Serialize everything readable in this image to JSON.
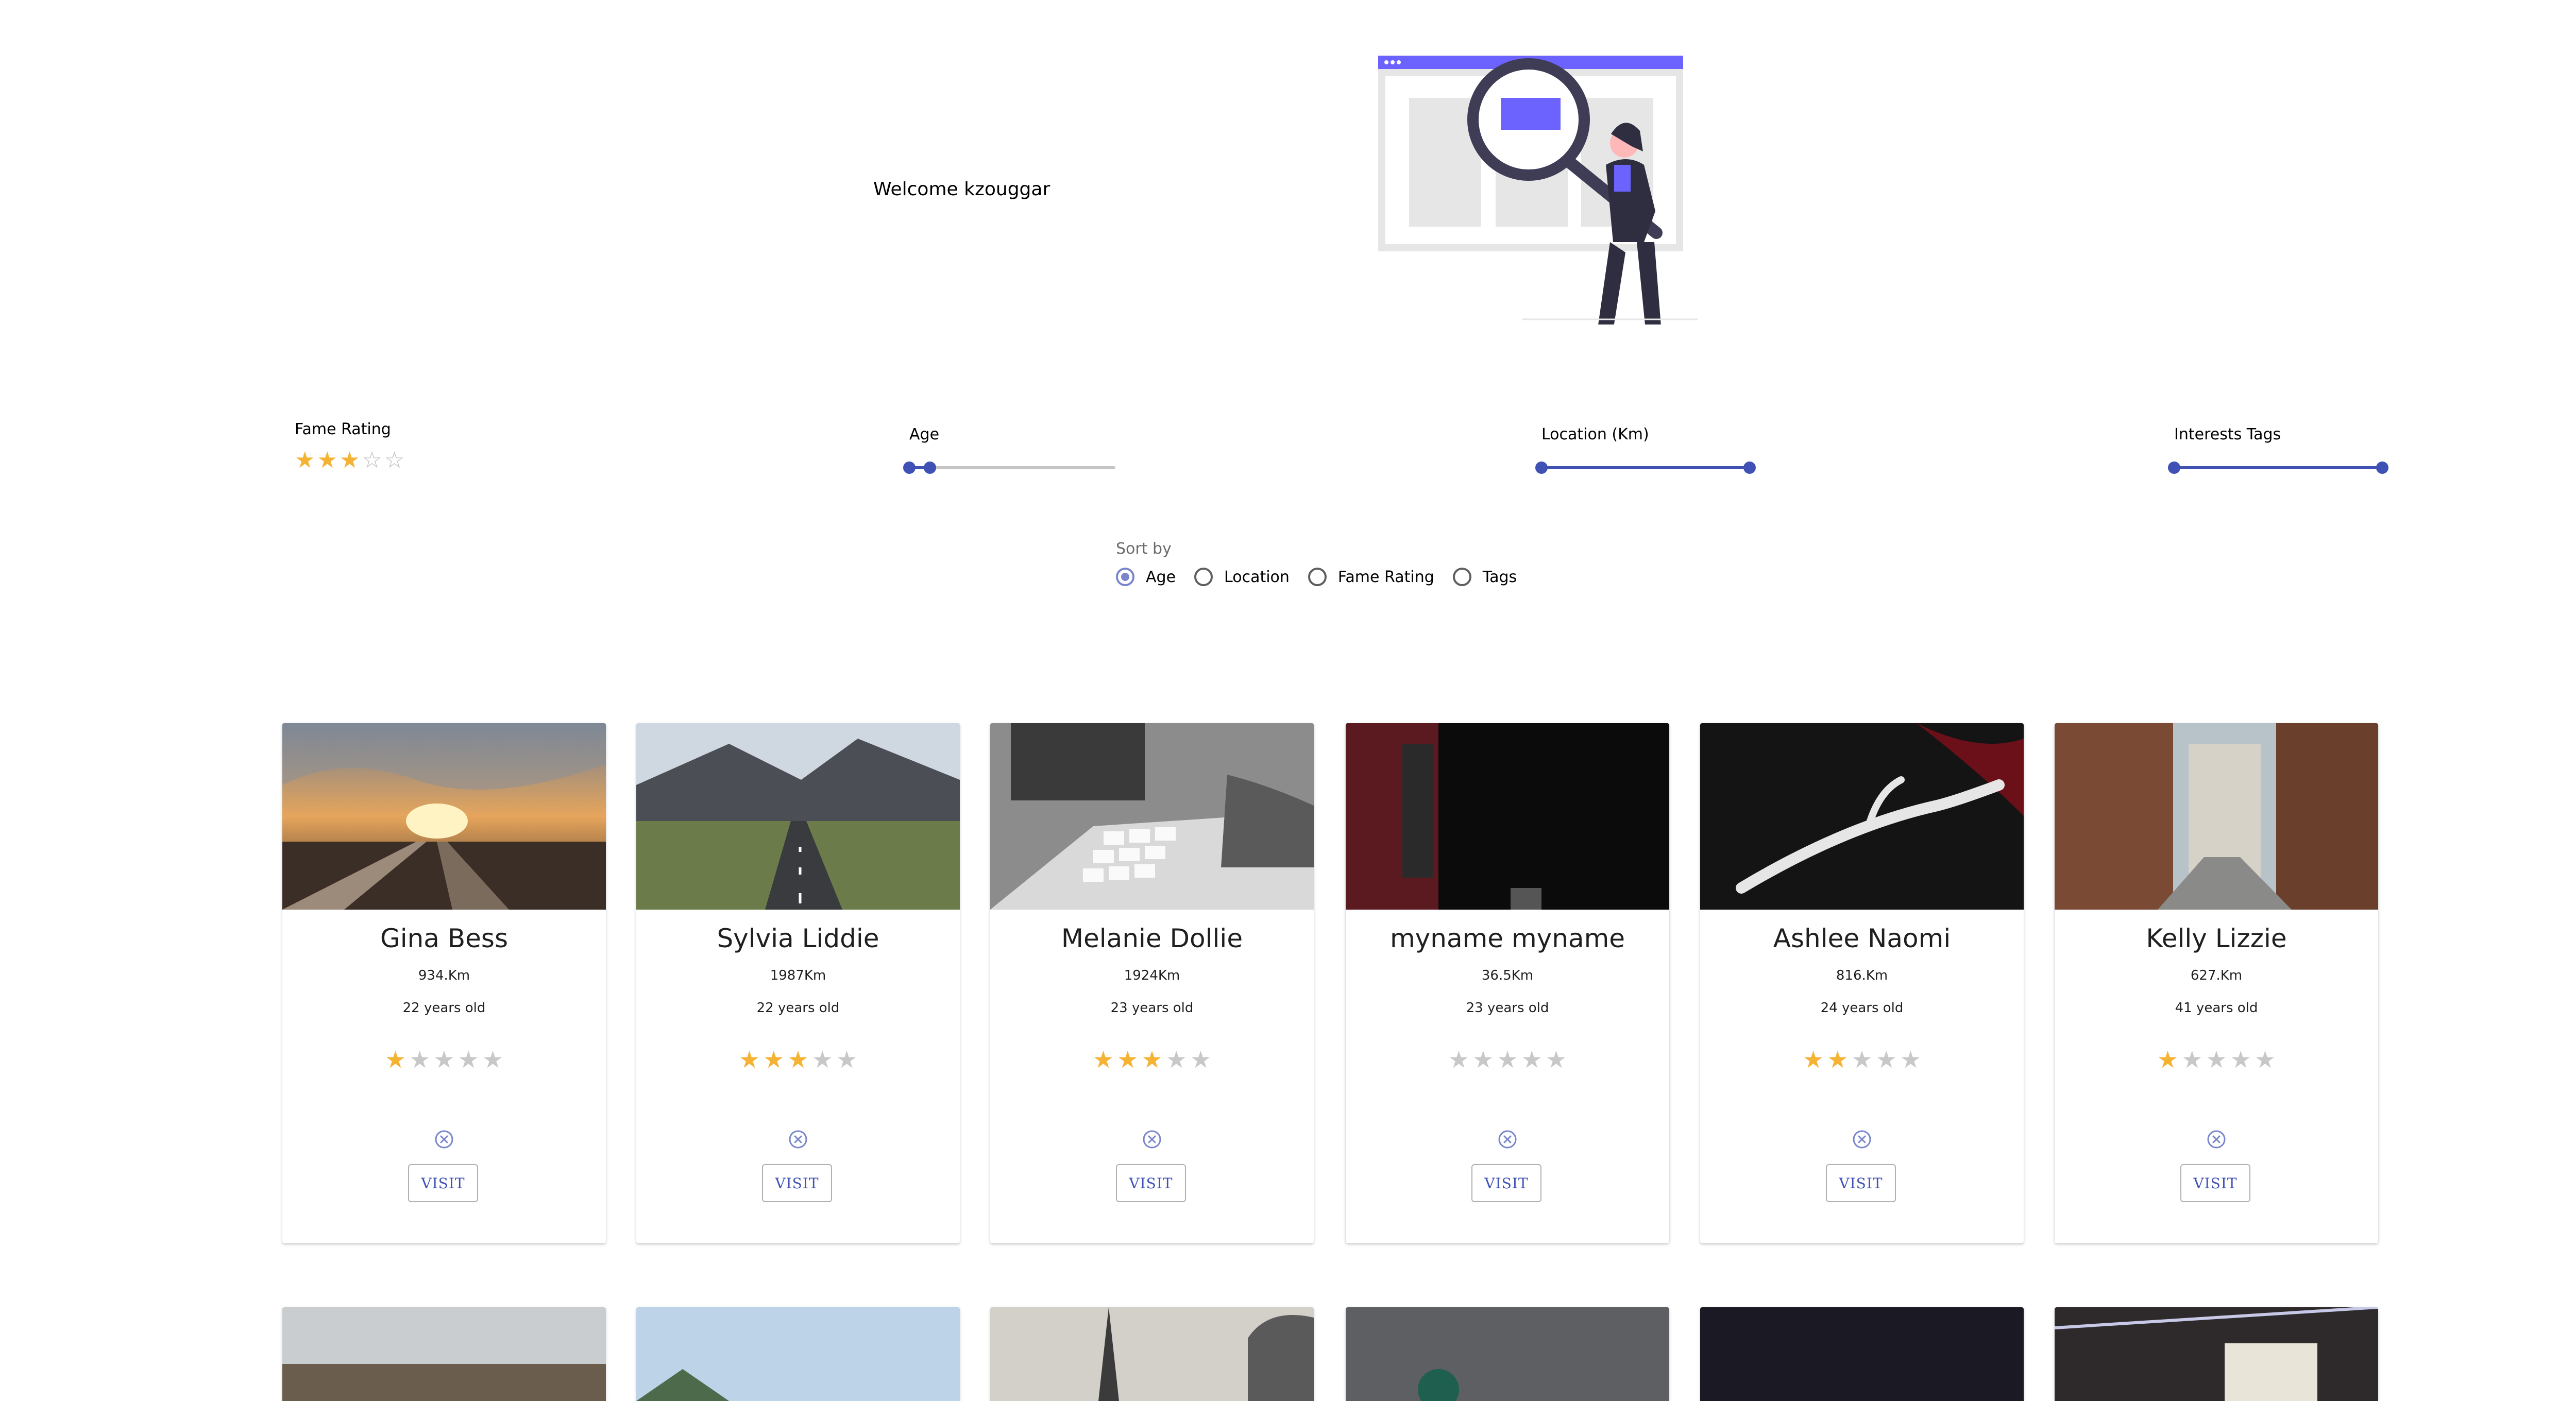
{
  "header": {
    "welcome_text": "Welcome kzouggar"
  },
  "filters": {
    "fame_label": "Fame Rating",
    "fame_value": 3,
    "fame_max": 5,
    "age_label": "Age",
    "location_label": "Location (Km)",
    "tags_label": "Interests Tags"
  },
  "sort": {
    "label": "Sort by",
    "options": [
      "Age",
      "Location",
      "Fame Rating",
      "Tags"
    ],
    "selected": "Age"
  },
  "profiles": [
    {
      "name": "Gina Bess",
      "distance": "934.Km",
      "age": "22 years old",
      "rating": 1,
      "visit": "VISIT"
    },
    {
      "name": "Sylvia Liddie",
      "distance": "1987Km",
      "age": "22 years old",
      "rating": 3,
      "visit": "VISIT"
    },
    {
      "name": "Melanie Dollie",
      "distance": "1924Km",
      "age": "23 years old",
      "rating": 3,
      "visit": "VISIT"
    },
    {
      "name": "myname myname",
      "distance": "36.5Km",
      "age": "23 years old",
      "rating": 0,
      "visit": "VISIT"
    },
    {
      "name": "Ashlee Naomi",
      "distance": "816.Km",
      "age": "24 years old",
      "rating": 2,
      "visit": "VISIT"
    },
    {
      "name": "Kelly Lizzie",
      "distance": "627.Km",
      "age": "41 years old",
      "rating": 1,
      "visit": "VISIT"
    }
  ],
  "colors": {
    "accent": "#3f51b5",
    "star": "#f5b335",
    "illustration_purple": "#6c63ff"
  },
  "icons": {
    "remove": "close-circle-icon",
    "star": "star-icon"
  }
}
